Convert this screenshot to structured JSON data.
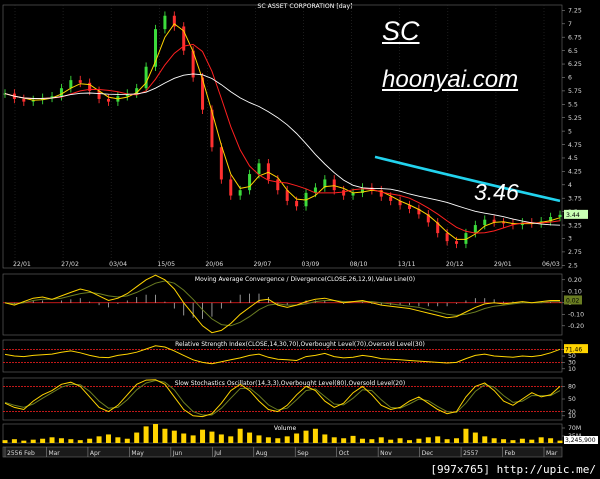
{
  "chart_data": [
    {
      "type": "candlestick",
      "title": "SC ASSET CORPORATION [day]",
      "y_ticks": [
        "7.25",
        "7",
        "6.75",
        "6.5",
        "6.25",
        "6",
        "5.75",
        "5.5",
        "5.25",
        "5",
        "4.75",
        "4.5",
        "4.25",
        "4",
        "3.75",
        "3.5",
        "3.25",
        "3",
        "2.75",
        "2.5"
      ],
      "ylim": [
        2.45,
        7.35
      ],
      "last_price_label": "3.44",
      "x_date_labels": [
        "22/01",
        "27/02",
        "03/04",
        "15/05",
        "20/06",
        "29/07",
        "03/09",
        "08/10",
        "13/11",
        "20/12",
        "29/01",
        "06/03"
      ],
      "x_month_labels": [
        "2556 Feb",
        "Mar",
        "Apr",
        "May",
        "Jun",
        "Jul",
        "Aug",
        "Sep",
        "Oct",
        "Nov",
        "Dec",
        "2557",
        "Feb",
        "Mar"
      ],
      "price_series": [
        5.7,
        5.6,
        5.55,
        5.58,
        5.62,
        5.65,
        5.8,
        5.95,
        5.9,
        5.75,
        5.6,
        5.55,
        5.65,
        5.7,
        5.8,
        6.2,
        6.9,
        7.15,
        6.95,
        6.5,
        6.0,
        5.4,
        4.7,
        4.1,
        3.8,
        3.9,
        4.2,
        4.4,
        4.1,
        3.9,
        3.7,
        3.6,
        3.85,
        3.95,
        4.1,
        3.9,
        3.8,
        3.85,
        3.95,
        3.9,
        3.78,
        3.7,
        3.62,
        3.55,
        3.45,
        3.3,
        3.1,
        2.95,
        2.9,
        3.1,
        3.25,
        3.35,
        3.3,
        3.28,
        3.25,
        3.3,
        3.28,
        3.32,
        3.4,
        3.44
      ],
      "overlays": [
        {
          "name": "short-ma",
          "color": "#ffd400"
        },
        {
          "name": "mid-ma",
          "color": "#ff2020"
        },
        {
          "name": "long-ma",
          "color": "#ffffff"
        }
      ],
      "trend_line": {
        "color": "#22d3ee",
        "from": 4.52,
        "to": 3.7
      },
      "colors": {
        "up": "#3cdc3c",
        "down": "#ff3030"
      }
    },
    {
      "type": "line",
      "title": "Moving Average Convergence / Divergence(CLOSE,26,12,9),Value Line(0)",
      "y_ticks": [
        "0.20",
        "0.10",
        "0",
        "-0.10",
        "-0.20"
      ],
      "ylim": [
        -0.28,
        0.25
      ],
      "last_value_label": "0.02",
      "series": [
        {
          "name": "MACD",
          "values": [
            0.0,
            -0.02,
            0.01,
            0.04,
            0.05,
            0.03,
            0.06,
            0.09,
            0.12,
            0.1,
            0.06,
            0.02,
            0.04,
            0.08,
            0.14,
            0.2,
            0.24,
            0.2,
            0.12,
            0.0,
            -0.1,
            -0.2,
            -0.26,
            -0.24,
            -0.18,
            -0.1,
            -0.04,
            0.02,
            0.03,
            -0.02,
            -0.04,
            -0.02,
            0.01,
            0.03,
            0.04,
            0.02,
            0.0,
            0.01,
            0.02,
            0.0,
            -0.02,
            -0.03,
            -0.04,
            -0.05,
            -0.07,
            -0.09,
            -0.11,
            -0.13,
            -0.12,
            -0.08,
            -0.04,
            -0.01,
            0.0,
            -0.01,
            0.0,
            0.01,
            0.0,
            0.01,
            0.02,
            0.02
          ]
        },
        {
          "name": "Signal",
          "values": [
            0.0,
            -0.01,
            0.0,
            0.02,
            0.03,
            0.03,
            0.04,
            0.06,
            0.08,
            0.09,
            0.08,
            0.06,
            0.05,
            0.06,
            0.09,
            0.13,
            0.17,
            0.19,
            0.17,
            0.11,
            0.03,
            -0.06,
            -0.14,
            -0.19,
            -0.2,
            -0.17,
            -0.12,
            -0.06,
            -0.02,
            -0.01,
            -0.02,
            -0.02,
            -0.01,
            0.01,
            0.02,
            0.02,
            0.01,
            0.01,
            0.01,
            0.01,
            0.0,
            -0.01,
            -0.02,
            -0.03,
            -0.04,
            -0.06,
            -0.08,
            -0.1,
            -0.11,
            -0.1,
            -0.08,
            -0.05,
            -0.03,
            -0.02,
            -0.01,
            0.0,
            0.0,
            0.0,
            0.01,
            0.01
          ]
        }
      ],
      "colors": {
        "macd": "#ffd400",
        "signal": "#6a7d22",
        "zero": "#ff2020",
        "bar": "#b8b8b8"
      }
    },
    {
      "type": "line",
      "title": "Relative Strength Index(CLOSE,14,30,70),Overbought Level(70),Oversold Level(30)",
      "y_ticks": [
        "70",
        "50",
        "30",
        "10"
      ],
      "ylim": [
        0,
        100
      ],
      "last_value_label": "71.46",
      "series": [
        {
          "name": "RSI",
          "values": [
            55,
            50,
            48,
            52,
            54,
            56,
            62,
            66,
            60,
            52,
            46,
            45,
            52,
            56,
            62,
            72,
            82,
            78,
            66,
            52,
            38,
            30,
            26,
            32,
            38,
            44,
            52,
            56,
            46,
            40,
            38,
            36,
            48,
            52,
            58,
            48,
            44,
            46,
            52,
            48,
            42,
            40,
            38,
            36,
            34,
            32,
            30,
            28,
            30,
            42,
            52,
            56,
            50,
            48,
            46,
            50,
            48,
            52,
            60,
            71
          ]
        }
      ],
      "colors": {
        "line": "#ffd400",
        "level": "#ff2020"
      }
    },
    {
      "type": "line",
      "title": "Slow Stochastics Oscillator(14,3,3),Overbought Level(80),Oversold Level(20)",
      "y_ticks": [
        "80",
        "50",
        "20",
        "10"
      ],
      "ylim": [
        0,
        100
      ],
      "series": [
        {
          "name": "%K",
          "values": [
            40,
            30,
            25,
            45,
            60,
            70,
            85,
            90,
            80,
            55,
            30,
            20,
            35,
            60,
            85,
            95,
            96,
            85,
            55,
            25,
            10,
            8,
            15,
            40,
            70,
            85,
            70,
            45,
            25,
            20,
            35,
            60,
            80,
            70,
            45,
            30,
            40,
            65,
            80,
            60,
            35,
            25,
            30,
            45,
            55,
            40,
            25,
            15,
            20,
            55,
            80,
            88,
            70,
            45,
            35,
            50,
            65,
            55,
            60,
            80
          ]
        },
        {
          "name": "%D",
          "values": [
            42,
            35,
            30,
            38,
            52,
            65,
            78,
            85,
            84,
            68,
            45,
            28,
            30,
            48,
            72,
            88,
            94,
            90,
            72,
            42,
            20,
            12,
            12,
            28,
            52,
            75,
            76,
            58,
            36,
            24,
            28,
            48,
            70,
            74,
            56,
            38,
            36,
            52,
            72,
            70,
            48,
            30,
            28,
            38,
            50,
            46,
            32,
            20,
            18,
            40,
            68,
            84,
            78,
            58,
            42,
            45,
            58,
            58,
            58,
            70
          ]
        }
      ],
      "colors": {
        "k": "#ffd400",
        "d": "#6a7d22",
        "level": "#ff2020"
      }
    },
    {
      "type": "bar",
      "title": "Volume",
      "y_ticks": [
        "70M",
        "35M"
      ],
      "last_value_label": "3,245,900",
      "values": [
        6,
        8,
        5,
        7,
        9,
        12,
        10,
        8,
        6,
        9,
        14,
        18,
        12,
        9,
        22,
        35,
        40,
        30,
        26,
        20,
        16,
        28,
        24,
        18,
        14,
        30,
        22,
        16,
        12,
        10,
        14,
        20,
        26,
        30,
        18,
        12,
        10,
        15,
        9,
        8,
        12,
        7,
        10,
        6,
        9,
        12,
        14,
        8,
        10,
        30,
        22,
        14,
        10,
        8,
        6,
        9,
        7,
        12,
        10,
        5
      ],
      "colors": {
        "bar": "#ffd400"
      }
    }
  ],
  "watermark": {
    "ticker": "SC",
    "site": "hoonyai.com",
    "price_note": "3.46"
  },
  "footer": {
    "text": "[997x765] http://upic.me/"
  }
}
